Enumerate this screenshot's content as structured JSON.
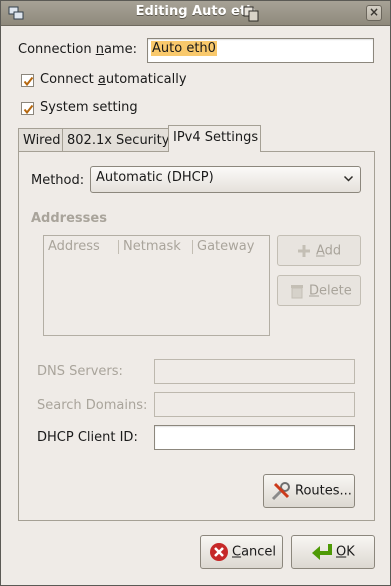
{
  "window": {
    "title": "Editing Auto eth0",
    "title_visible": "Editing Auto eth"
  },
  "connection_name": {
    "label_pre": "Connection ",
    "label_u": "n",
    "label_post": "ame:",
    "value": "Auto eth0"
  },
  "connect_auto": {
    "label_pre": "Connect ",
    "label_u": "a",
    "label_post": "utomatically",
    "checked": true
  },
  "system_setting": {
    "label": "System setting",
    "checked": true
  },
  "tabs": [
    {
      "label": "Wired",
      "active": false
    },
    {
      "label": "802.1x Security",
      "active": false
    },
    {
      "label": "IPv4 Settings",
      "active": true
    }
  ],
  "ipv4": {
    "method_label": "Method:",
    "method_value": "Automatic (DHCP)",
    "addresses_heading": "Addresses",
    "columns": [
      "Address",
      "Netmask",
      "Gateway"
    ],
    "add_u": "A",
    "add_rest": "dd",
    "delete_u": "D",
    "delete_rest": "elete",
    "dns_label": "DNS Servers:",
    "search_label": "Search Domains:",
    "dhcp_label": "DHCP Client ID:",
    "dns_value": "",
    "search_value": "",
    "dhcp_value": "",
    "routes_label": "Routes..."
  },
  "footer": {
    "cancel_u": "C",
    "cancel_rest": "ancel",
    "ok_u": "O",
    "ok_rest": "K"
  },
  "colors": {
    "accent_selection": "#f9c96c",
    "cancel_red": "#c62828",
    "ok_green": "#4e9a06"
  }
}
